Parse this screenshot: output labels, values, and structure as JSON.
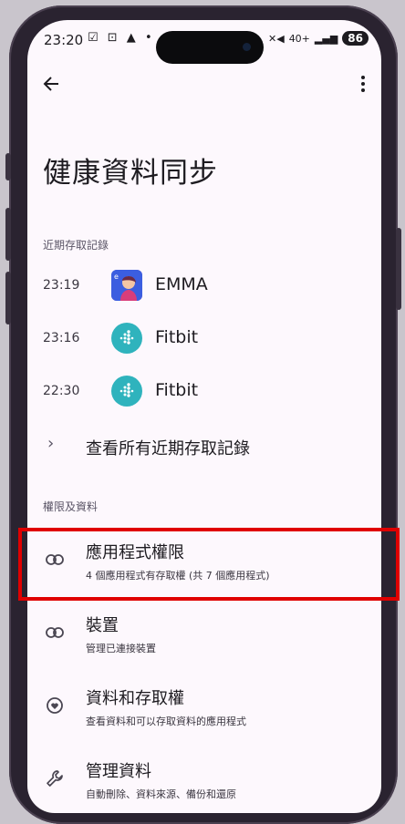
{
  "status_bar": {
    "time": "23:20",
    "left_icons": "☑ ⊡ ▲ •",
    "network": "40+",
    "battery": "86"
  },
  "page": {
    "title": "健康資料同步"
  },
  "recent_access": {
    "header": "近期存取記錄",
    "items": [
      {
        "time": "23:19",
        "app": "EMMA",
        "icon": "emma-app-icon"
      },
      {
        "time": "23:16",
        "app": "Fitbit",
        "icon": "fitbit-icon"
      },
      {
        "time": "22:30",
        "app": "Fitbit",
        "icon": "fitbit-icon"
      }
    ],
    "see_all": "查看所有近期存取記錄"
  },
  "permissions": {
    "header": "權限及資料",
    "items": [
      {
        "title": "應用程式權限",
        "subtitle": "4 個應用程式有存取權 (共 7 個應用程式)",
        "icon": "link-icon"
      },
      {
        "title": "裝置",
        "subtitle": "管理已連接裝置",
        "icon": "link-icon"
      },
      {
        "title": "資料和存取權",
        "subtitle": "查看資料和可以存取資料的應用程式",
        "icon": "heart-shield-icon"
      },
      {
        "title": "管理資料",
        "subtitle": "自動刪除、資料來源、備份和還原",
        "icon": "wrench-icon"
      }
    ]
  },
  "colors": {
    "highlight": "#e00000",
    "fitbit": "#2fb3bd",
    "background": "#fdf8fd"
  }
}
